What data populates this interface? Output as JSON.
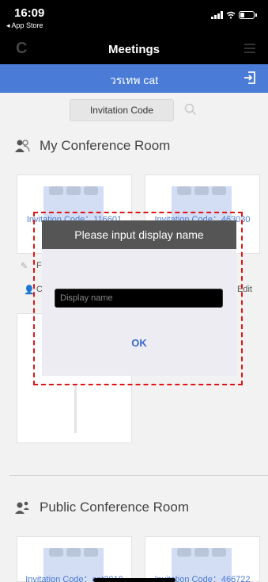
{
  "status_bar": {
    "time": "16:09",
    "back_app": "◂ App Store"
  },
  "nav": {
    "title": "Meetings",
    "refresh_icon": "refresh-icon",
    "list_icon": "list-icon"
  },
  "user_bar": {
    "name": "วรเทพ cat",
    "logout_icon": "logout-icon"
  },
  "search": {
    "button_label": "Invitation Code",
    "icon": "search-icon"
  },
  "my_rooms": {
    "title": "My Conference Room",
    "cards": [
      {
        "code": "Invitation Code：116601",
        "frag1": "F",
        "frag2": "C"
      },
      {
        "code": "Invitation Code：463030",
        "frag1": "Edit"
      }
    ]
  },
  "public_rooms": {
    "title": "Public Conference Room",
    "cards": [
      {
        "code": "Invitation Code：cat2019"
      },
      {
        "code": "Invitation Code：466722"
      }
    ]
  },
  "dialog": {
    "title": "Please input display name",
    "input_placeholder": "Display name",
    "ok_label": "OK"
  },
  "colors": {
    "accent": "#4a7bd6",
    "highlight": "#e01414",
    "dialog_header": "#555555"
  }
}
